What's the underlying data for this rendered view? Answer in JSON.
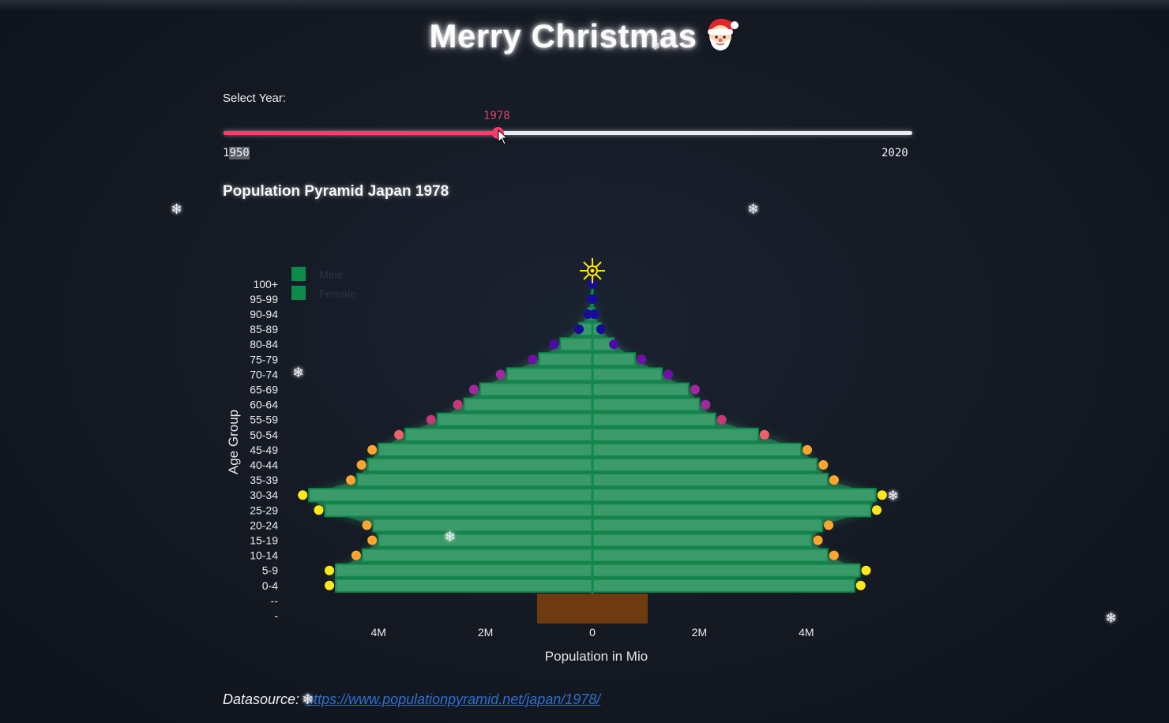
{
  "page_title": "Merry Christmas",
  "title_emoji": "santa-face-icon",
  "slider": {
    "label": "Select Year:",
    "value": "1978",
    "min": "1950",
    "max": "2020",
    "fraction": 0.4,
    "fill_color": "#ff3d6a"
  },
  "chart_title": "Population Pyramid Japan 1978",
  "chart_data": {
    "type": "bar",
    "orientation": "horizontal",
    "title": "Population Pyramid Japan 1978",
    "categories": [
      "-",
      "--",
      "0-4",
      "5-9",
      "10-14",
      "15-19",
      "20-24",
      "25-29",
      "30-34",
      "35-39",
      "40-44",
      "45-49",
      "50-54",
      "55-59",
      "60-64",
      "65-69",
      "70-74",
      "75-79",
      "80-84",
      "85-89",
      "90-94",
      "95-99",
      "100+"
    ],
    "series": [
      {
        "name": "Male",
        "values": [
          0,
          0,
          4.8,
          4.8,
          4.3,
          4.0,
          4.1,
          5.0,
          5.3,
          4.4,
          4.2,
          4.0,
          3.5,
          2.9,
          2.4,
          2.1,
          1.6,
          1.0,
          0.6,
          0.25,
          0.08,
          0.02,
          0.005
        ]
      },
      {
        "name": "Female",
        "values": [
          0,
          0,
          4.9,
          5.0,
          4.4,
          4.1,
          4.3,
          5.2,
          5.3,
          4.4,
          4.2,
          3.9,
          3.1,
          2.3,
          2.0,
          1.8,
          1.3,
          0.8,
          0.4,
          0.16,
          0.04,
          0.01,
          0.005
        ]
      }
    ],
    "xlabel": "Population in Mio",
    "ylabel": "Age Group",
    "xlim": [
      -5.5,
      5.5
    ],
    "x_ticks": [
      {
        "value": -4,
        "label": "4M"
      },
      {
        "value": -2,
        "label": "2M"
      },
      {
        "value": 0,
        "label": "0"
      },
      {
        "value": 2,
        "label": "2M"
      },
      {
        "value": 4,
        "label": "4M"
      }
    ],
    "legend": [
      "Male",
      "Female"
    ],
    "legend_position": "top-left",
    "bar_color": "#3a9a6a",
    "trunk_color": "#6e3a10",
    "grid": false
  },
  "footer": {
    "label": "Datasource:",
    "link": "https://www.populationpyramid.net/japan/1978/"
  },
  "snowflake_char": "❄"
}
